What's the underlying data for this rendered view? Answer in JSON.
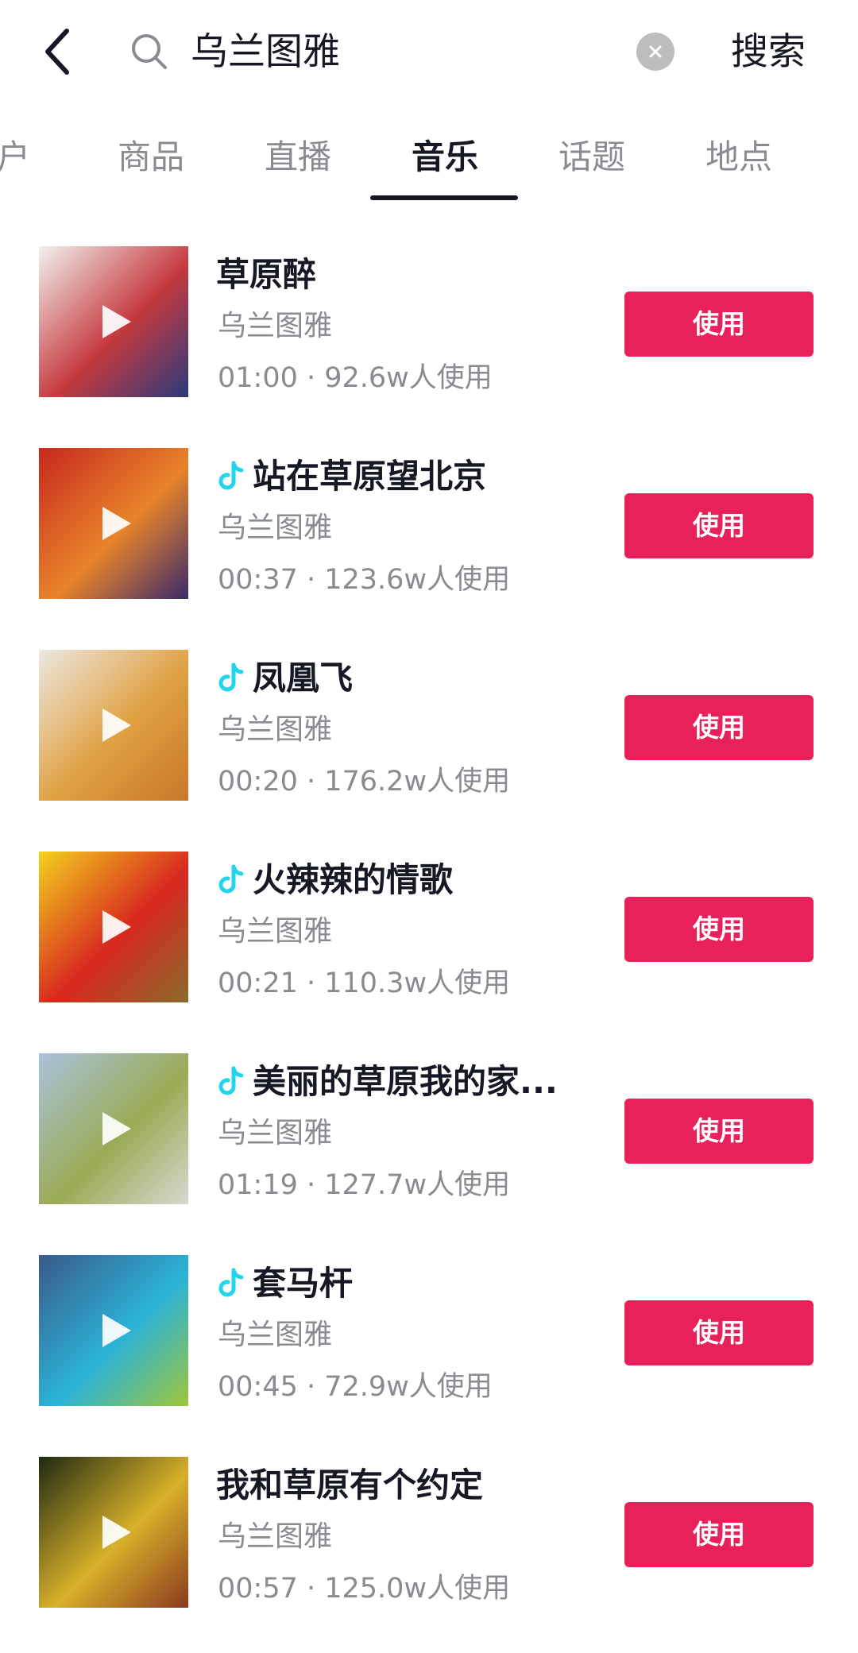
{
  "search": {
    "query": "乌兰图雅",
    "search_label": "搜索"
  },
  "tabs": [
    {
      "label": "户",
      "active": false
    },
    {
      "label": "商品",
      "active": false
    },
    {
      "label": "直播",
      "active": false
    },
    {
      "label": "音乐",
      "active": true
    },
    {
      "label": "话题",
      "active": false
    },
    {
      "label": "地点",
      "active": false
    }
  ],
  "music_list": [
    {
      "title": "草原醉",
      "artist": "乌兰图雅",
      "meta": "01:00 · 92.6w人使用",
      "use_label": "使用",
      "original": false,
      "cover_colors": [
        "#f2f2ee",
        "#c63a3f",
        "#2a3a7a"
      ]
    },
    {
      "title": "站在草原望北京",
      "artist": "乌兰图雅",
      "meta": "00:37 · 123.6w人使用",
      "use_label": "使用",
      "original": true,
      "cover_colors": [
        "#c7281e",
        "#e8842a",
        "#3a2a6a"
      ]
    },
    {
      "title": "凤凰飞",
      "artist": "乌兰图雅",
      "meta": "00:20 · 176.2w人使用",
      "use_label": "使用",
      "original": true,
      "cover_colors": [
        "#ece8e2",
        "#e0a040",
        "#c9772a"
      ]
    },
    {
      "title": "火辣辣的情歌",
      "artist": "乌兰图雅",
      "meta": "00:21 · 110.3w人使用",
      "use_label": "使用",
      "original": true,
      "cover_colors": [
        "#f2d21e",
        "#d8281e",
        "#8a6a2a"
      ]
    },
    {
      "title": "美丽的草原我的家...",
      "artist": "乌兰图雅",
      "meta": "01:19 · 127.7w人使用",
      "use_label": "使用",
      "original": true,
      "cover_colors": [
        "#a9c3dc",
        "#9aab55",
        "#d8d8d0"
      ]
    },
    {
      "title": "套马杆",
      "artist": "乌兰图雅",
      "meta": "00:45 · 72.9w人使用",
      "use_label": "使用",
      "original": true,
      "cover_colors": [
        "#3a5a8a",
        "#2bb3d8",
        "#9ec63a"
      ]
    },
    {
      "title": "我和草原有个约定",
      "artist": "乌兰图雅",
      "meta": "00:57 · 125.0w人使用",
      "use_label": "使用",
      "original": false,
      "cover_colors": [
        "#1e2a12",
        "#d8b02a",
        "#8a3a1e"
      ]
    }
  ],
  "colors": {
    "accent": "#e8215a",
    "original_icon": "#20d5ec",
    "secondary_text": "#8a8b91",
    "primary_text": "#161823"
  },
  "icons": {
    "back": "chevron-left-icon",
    "search": "search-icon",
    "clear": "clear-icon",
    "play": "play-icon",
    "original": "tiktok-note-icon"
  }
}
